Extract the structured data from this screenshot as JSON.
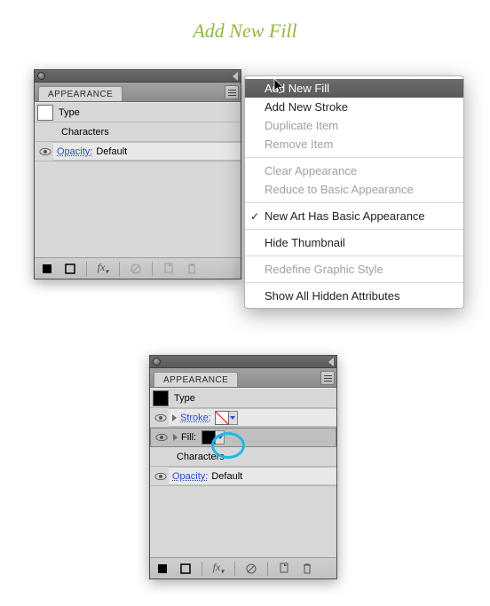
{
  "heading": "Add New Fill",
  "panel_a": {
    "tab": "APPEARANCE",
    "rows": {
      "type_label": "Type",
      "characters_label": "Characters",
      "opacity_label": "Opacity:",
      "opacity_value": "Default"
    },
    "footer_fx": "fx"
  },
  "menu": {
    "items": [
      "Add New Fill",
      "Add New Stroke",
      "Duplicate Item",
      "Remove Item",
      "Clear Appearance",
      "Reduce to Basic Appearance",
      "New Art Has Basic Appearance",
      "Hide Thumbnail",
      "Redefine Graphic Style",
      "Show All Hidden Attributes"
    ]
  },
  "panel_b": {
    "tab": "APPEARANCE",
    "rows": {
      "type_label": "Type",
      "stroke_label": "Stroke:",
      "fill_label": "Fill:",
      "characters_label": "Characters",
      "opacity_label": "Opacity:",
      "opacity_value": "Default"
    },
    "footer_fx": "fx"
  }
}
